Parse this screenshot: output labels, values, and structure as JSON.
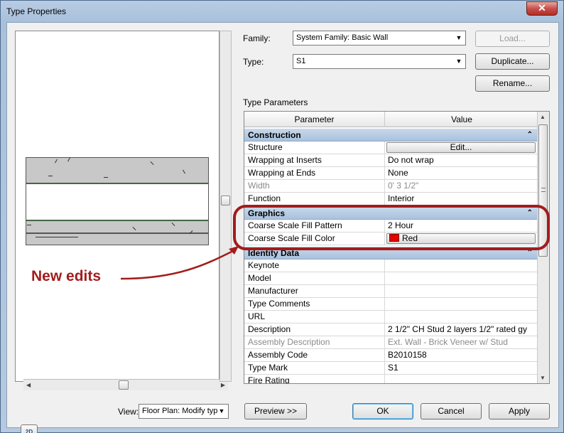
{
  "window": {
    "title": "Type Properties",
    "close_glyph": "✕"
  },
  "family": {
    "label": "Family:",
    "value": "System Family: Basic Wall"
  },
  "type": {
    "label": "Type:",
    "value": "S1"
  },
  "buttons": {
    "load": "Load...",
    "duplicate": "Duplicate...",
    "rename": "Rename...",
    "preview": "Preview >>",
    "ok": "OK",
    "cancel": "Cancel",
    "apply": "Apply"
  },
  "type_parameters": {
    "label": "Type Parameters",
    "col_parameter": "Parameter",
    "col_value": "Value",
    "groups": {
      "construction": "Construction",
      "graphics": "Graphics",
      "identity": "Identity Data"
    },
    "collapse_glyph": "⌃"
  },
  "rows": {
    "structure": {
      "p": "Structure",
      "v": "Edit..."
    },
    "wrap_inserts": {
      "p": "Wrapping at Inserts",
      "v": "Do not wrap"
    },
    "wrap_ends": {
      "p": "Wrapping at Ends",
      "v": "None"
    },
    "width": {
      "p": "Width",
      "v": "0'  3 1/2\""
    },
    "function": {
      "p": "Function",
      "v": "Interior"
    },
    "fill_pattern": {
      "p": "Coarse Scale Fill Pattern",
      "v": "2 Hour"
    },
    "fill_color": {
      "p": "Coarse Scale Fill Color",
      "v": "Red",
      "swatch": "#e00000"
    },
    "keynote": {
      "p": "Keynote",
      "v": ""
    },
    "model": {
      "p": "Model",
      "v": ""
    },
    "manufacturer": {
      "p": "Manufacturer",
      "v": ""
    },
    "type_comments": {
      "p": "Type Comments",
      "v": ""
    },
    "url": {
      "p": "URL",
      "v": ""
    },
    "description": {
      "p": "Description",
      "v": "2 1/2\" CH Stud 2 layers 1/2\" rated gy"
    },
    "assembly_description": {
      "p": "Assembly Description",
      "v": "Ext. Wall - Brick Veneer w/ Stud"
    },
    "assembly_code": {
      "p": "Assembly Code",
      "v": "B2010158"
    },
    "type_mark": {
      "p": "Type Mark",
      "v": "S1"
    },
    "fire_rating": {
      "p": "Fire Rating",
      "v": ""
    }
  },
  "view": {
    "label": "View:",
    "value": "Floor Plan: Modify typ"
  },
  "annotation": {
    "text": "New edits",
    "color": "#a31c1c"
  },
  "icons": {
    "view_2d": "2D"
  }
}
